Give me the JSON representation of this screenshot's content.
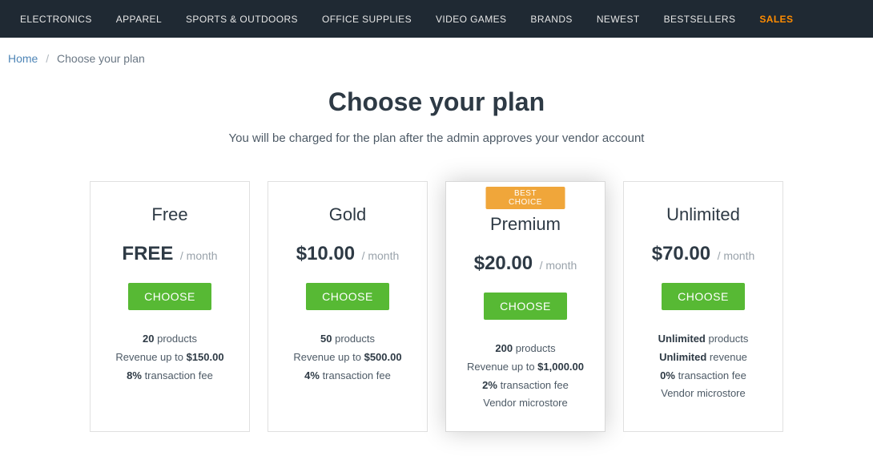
{
  "nav": {
    "items": [
      {
        "label": "ELECTRONICS"
      },
      {
        "label": "APPAREL"
      },
      {
        "label": "SPORTS & OUTDOORS"
      },
      {
        "label": "OFFICE SUPPLIES"
      },
      {
        "label": "VIDEO GAMES"
      },
      {
        "label": "BRANDS"
      },
      {
        "label": "NEWEST"
      },
      {
        "label": "BESTSELLERS"
      },
      {
        "label": "SALES"
      }
    ]
  },
  "breadcrumbs": {
    "home": "Home",
    "current": "Choose your plan"
  },
  "header": {
    "title": "Choose your plan",
    "subtitle": "You will be charged for the plan after the admin approves your vendor account"
  },
  "plans": [
    {
      "name": "Free",
      "price": "FREE",
      "period": "/ month",
      "choose_label": "CHOOSE",
      "featured": false,
      "badge": null,
      "features": [
        {
          "strong": "20",
          "rest": " products"
        },
        {
          "pre": "Revenue up to ",
          "strong": "$150.00",
          "rest": ""
        },
        {
          "strong": "8%",
          "rest": " transaction fee"
        }
      ]
    },
    {
      "name": "Gold",
      "price": "$10.00",
      "period": "/ month",
      "choose_label": "CHOOSE",
      "featured": false,
      "badge": null,
      "features": [
        {
          "strong": "50",
          "rest": " products"
        },
        {
          "pre": "Revenue up to ",
          "strong": "$500.00",
          "rest": ""
        },
        {
          "strong": "4%",
          "rest": " transaction fee"
        }
      ]
    },
    {
      "name": "Premium",
      "price": "$20.00",
      "period": "/ month",
      "choose_label": "CHOOSE",
      "featured": true,
      "badge": "BEST CHOICE",
      "features": [
        {
          "strong": "200",
          "rest": " products"
        },
        {
          "pre": "Revenue up to ",
          "strong": "$1,000.00",
          "rest": ""
        },
        {
          "strong": "2%",
          "rest": " transaction fee"
        },
        {
          "pre": "Vendor microstore",
          "strong": "",
          "rest": ""
        }
      ]
    },
    {
      "name": "Unlimited",
      "price": "$70.00",
      "period": "/ month",
      "choose_label": "CHOOSE",
      "featured": false,
      "badge": null,
      "features": [
        {
          "strong": "Unlimited",
          "rest": " products"
        },
        {
          "strong": "Unlimited",
          "rest": " revenue"
        },
        {
          "strong": "0%",
          "rest": " transaction fee"
        },
        {
          "pre": "Vendor microstore",
          "strong": "",
          "rest": ""
        }
      ]
    }
  ]
}
